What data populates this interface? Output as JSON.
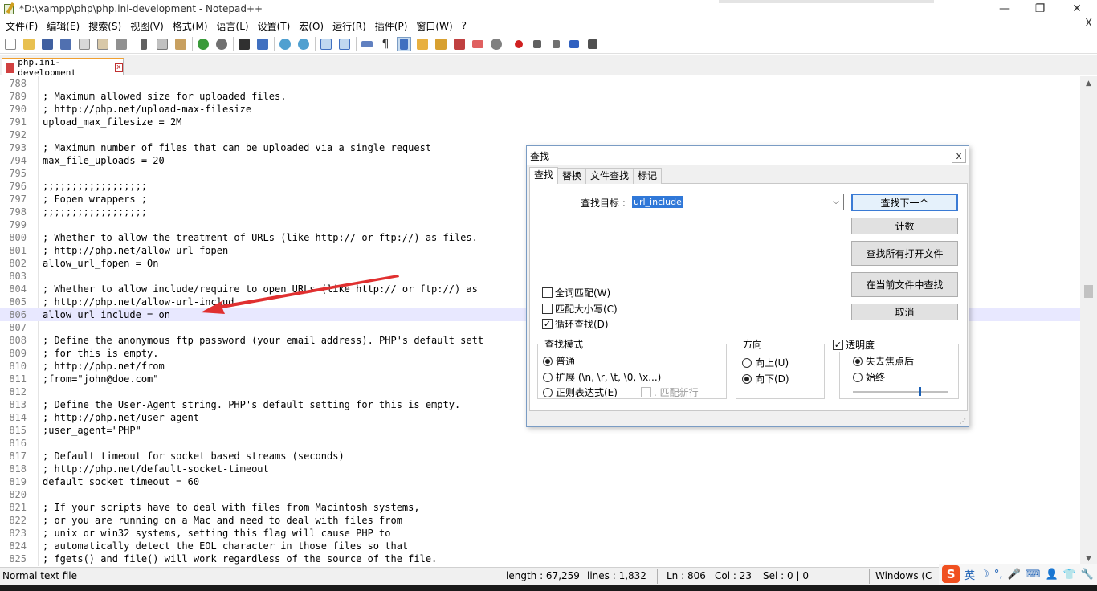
{
  "window": {
    "title": "*D:\\xampp\\php\\php.ini-development - Notepad++",
    "minimize_glyph": "—",
    "restore_glyph": "❐",
    "close_glyph": "✕"
  },
  "menu": [
    "文件(F)",
    "编辑(E)",
    "搜索(S)",
    "视图(V)",
    "格式(M)",
    "语言(L)",
    "设置(T)",
    "宏(O)",
    "运行(R)",
    "插件(P)",
    "窗口(W)",
    "?"
  ],
  "menu_close": "X",
  "tab": {
    "label": "php.ini-development",
    "close": "x"
  },
  "editor": {
    "current_line": 806,
    "lines": [
      {
        "n": "788",
        "t": ""
      },
      {
        "n": "789",
        "t": "; Maximum allowed size for uploaded files."
      },
      {
        "n": "790",
        "t": "; http://php.net/upload-max-filesize"
      },
      {
        "n": "791",
        "t": "upload_max_filesize = 2M"
      },
      {
        "n": "792",
        "t": ""
      },
      {
        "n": "793",
        "t": "; Maximum number of files that can be uploaded via a single request"
      },
      {
        "n": "794",
        "t": "max_file_uploads = 20"
      },
      {
        "n": "795",
        "t": ""
      },
      {
        "n": "796",
        "t": ";;;;;;;;;;;;;;;;;;"
      },
      {
        "n": "797",
        "t": "; Fopen wrappers ;"
      },
      {
        "n": "798",
        "t": ";;;;;;;;;;;;;;;;;;"
      },
      {
        "n": "799",
        "t": ""
      },
      {
        "n": "800",
        "t": "; Whether to allow the treatment of URLs (like http:// or ftp://) as files."
      },
      {
        "n": "801",
        "t": "; http://php.net/allow-url-fopen"
      },
      {
        "n": "802",
        "t": "allow_url_fopen = On"
      },
      {
        "n": "803",
        "t": ""
      },
      {
        "n": "804",
        "t": "; Whether to allow include/require to open URLs (like http:// or ftp://) as"
      },
      {
        "n": "805",
        "t": "; http://php.net/allow-url-includ"
      },
      {
        "n": "806",
        "t": "allow_url_include = on"
      },
      {
        "n": "807",
        "t": ""
      },
      {
        "n": "808",
        "t": "; Define the anonymous ftp password (your email address). PHP's default sett"
      },
      {
        "n": "809",
        "t": "; for this is empty."
      },
      {
        "n": "810",
        "t": "; http://php.net/from"
      },
      {
        "n": "811",
        "t": ";from=\"john@doe.com\""
      },
      {
        "n": "812",
        "t": ""
      },
      {
        "n": "813",
        "t": "; Define the User-Agent string. PHP's default setting for this is empty."
      },
      {
        "n": "814",
        "t": "; http://php.net/user-agent"
      },
      {
        "n": "815",
        "t": ";user_agent=\"PHP\""
      },
      {
        "n": "816",
        "t": ""
      },
      {
        "n": "817",
        "t": "; Default timeout for socket based streams (seconds)"
      },
      {
        "n": "818",
        "t": "; http://php.net/default-socket-timeout"
      },
      {
        "n": "819",
        "t": "default_socket_timeout = 60"
      },
      {
        "n": "820",
        "t": ""
      },
      {
        "n": "821",
        "t": "; If your scripts have to deal with files from Macintosh systems,"
      },
      {
        "n": "822",
        "t": "; or you are running on a Mac and need to deal with files from"
      },
      {
        "n": "823",
        "t": "; unix or win32 systems, setting this flag will cause PHP to"
      },
      {
        "n": "824",
        "t": "; automatically detect the EOL character in those files so that"
      },
      {
        "n": "825",
        "t": "; fgets() and file() will work regardless of the source of the file."
      }
    ]
  },
  "status": {
    "type": "Normal text file",
    "length": "length : 67,259",
    "lines": "lines : 1,832",
    "ln": "Ln : 806",
    "col": "Col : 23",
    "sel": "Sel : 0 | 0",
    "eol": "Windows (C"
  },
  "tray": {
    "ime": "S",
    "lang": "英",
    "moon": "☽",
    "punct": "°,",
    "mic": "🎤",
    "kbd": "⌨",
    "user": "👤",
    "shirt": "👕",
    "wrench": "🔧"
  },
  "dialog": {
    "title": "查找",
    "close": "x",
    "tabs": [
      "查找",
      "替换",
      "文件查找",
      "标记"
    ],
    "find_label": "查找目标 :",
    "find_value": "url_include",
    "combo_arrow": "⌵",
    "buttons": {
      "find_next": "查找下一个",
      "count": "计数",
      "find_all_open": "查找所有打开文件",
      "find_current": "在当前文件中查找",
      "cancel": "取消"
    },
    "options": {
      "whole_word": "全词匹配(W)",
      "match_case": "匹配大小写(C)",
      "wrap": "循环查找(D)",
      "wrap_check": "✓"
    },
    "search_mode": {
      "title": "查找模式",
      "normal": "普通",
      "extended": "扩展 (\\n, \\r, \\t, \\0, \\x...)",
      "regex": "正则表达式(E)",
      "dot_newline": ". 匹配新行"
    },
    "direction": {
      "title": "方向",
      "up": "向上(U)",
      "down": "向下(D)"
    },
    "transparency": {
      "title": "透明度",
      "title_check": "✓",
      "on_lose_focus": "失去焦点后",
      "always": "始终",
      "level": 0.7
    },
    "grip": "⋰"
  },
  "colors": {
    "accent": "#3a7bd5",
    "arrow": "#e03030",
    "current_line": "#e8e8ff",
    "tab_top": "#f0a030"
  }
}
